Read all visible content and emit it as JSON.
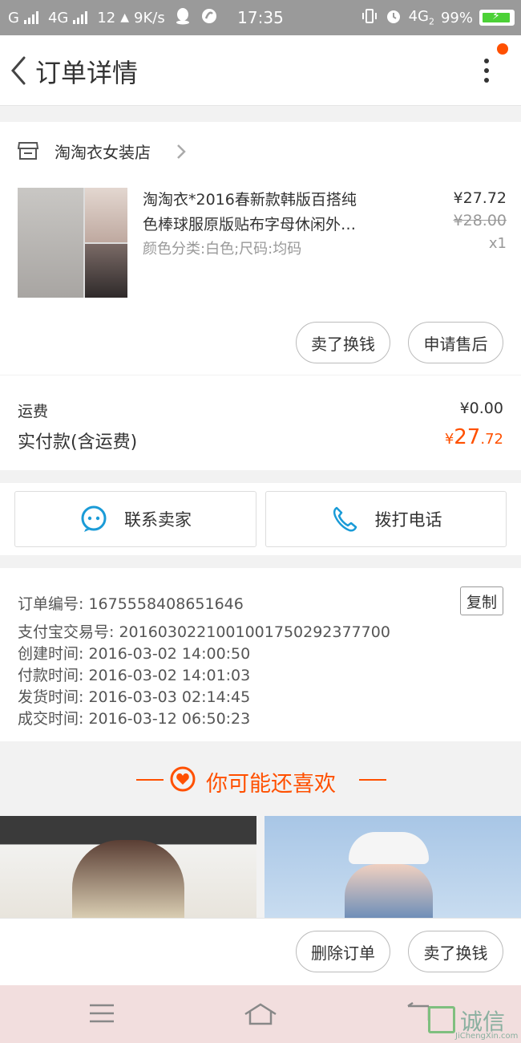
{
  "status_bar": {
    "carrier1": "G",
    "net1": "4G",
    "count": "12",
    "speed": "9K/s",
    "time": "17:35",
    "net2": "4G",
    "net2_sub": "2",
    "battery": "99%"
  },
  "header": {
    "title": "订单详情"
  },
  "shop": {
    "name": "淘淘衣女装店"
  },
  "item": {
    "title_line1": "淘淘衣*2016春新款韩版百搭纯",
    "title_line2": "色棒球服原版贴布字母休闲外…",
    "sku": "颜色分类:白色;尺码:均码",
    "price_now": "¥27.72",
    "price_old": "¥28.00",
    "qty": "x1",
    "btn_sell": "卖了换钱",
    "btn_after_sale": "申请售后"
  },
  "fees": {
    "shipping_label": "运费",
    "shipping_value": "¥0.00",
    "paid_label": "实付款(含运费)",
    "paid_currency": "¥",
    "paid_int": "27",
    "paid_dec": ".72"
  },
  "actions": {
    "contact_seller": "联系卖家",
    "call": "拨打电话"
  },
  "order_info": {
    "order_no": "订单编号: 1675558408651646",
    "copy": "复制",
    "alipay_no": "支付宝交易号: 2016030221001001750292377700",
    "created": "创建时间: 2016-03-02  14:00:50",
    "paid": "付款时间: 2016-03-02  14:01:03",
    "shipped": "发货时间: 2016-03-03  02:14:45",
    "completed": "成交时间: 2016-03-12  06:50:23"
  },
  "recommend": {
    "title": "你可能还喜欢"
  },
  "bottom_actions": {
    "delete": "删除订单",
    "sell": "卖了换钱"
  },
  "watermark": {
    "main": "诚信",
    "sub": "JiChengXin.com"
  },
  "colors": {
    "accent": "#ff5000",
    "status_bar": "#9a9a9a",
    "nav_bar": "#f2dede",
    "icon_blue": "#1a9bd7"
  },
  "icons": {
    "back": "chevron-left-icon",
    "more": "more-vertical-icon",
    "shop": "shop-icon",
    "chat": "chat-bubble-icon",
    "phone": "phone-icon",
    "heart": "heart-icon",
    "menu": "menu-icon",
    "home": "home-icon",
    "back_nav": "back-icon"
  }
}
